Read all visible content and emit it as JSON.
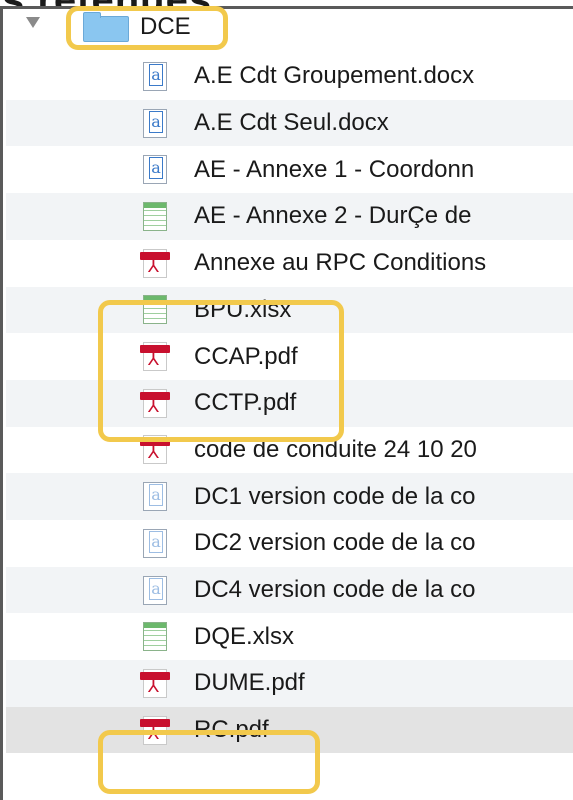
{
  "header": {
    "caption": "s retenues"
  },
  "folder": {
    "name": "DCE"
  },
  "files": [
    {
      "name": "A.E Cdt Groupement.docx",
      "type": "doc"
    },
    {
      "name": "A.E Cdt Seul.docx",
      "type": "doc"
    },
    {
      "name": "AE - Annexe 1 - Coordonn",
      "type": "doc"
    },
    {
      "name": "AE - Annexe 2 - DurÇe de",
      "type": "xls"
    },
    {
      "name": "Annexe au RPC Conditions",
      "type": "pdf"
    },
    {
      "name": "BPU.xlsx",
      "type": "xls"
    },
    {
      "name": "CCAP.pdf",
      "type": "pdf"
    },
    {
      "name": "CCTP.pdf",
      "type": "pdf"
    },
    {
      "name": "code de conduite 24 10 20",
      "type": "pdf"
    },
    {
      "name": "DC1 version code de la co",
      "type": "doc-faded"
    },
    {
      "name": "DC2 version code de la co",
      "type": "doc-faded"
    },
    {
      "name": "DC4 version code de la co",
      "type": "doc-faded"
    },
    {
      "name": "DQE.xlsx",
      "type": "xls"
    },
    {
      "name": "DUME.pdf",
      "type": "pdf"
    },
    {
      "name": "RC.pdf",
      "type": "pdf"
    }
  ],
  "selected_file": "RC.pdf",
  "icons": {
    "folder": "folder-icon",
    "doc": "word-document-icon",
    "xls": "spreadsheet-icon",
    "pdf": "pdf-icon",
    "disclosure": "disclosure-triangle-icon"
  },
  "colors": {
    "highlight": "#f2c94c",
    "folder": "#8ac6f0",
    "pdf": "#c8102e",
    "selection": "#e3e3e3"
  }
}
